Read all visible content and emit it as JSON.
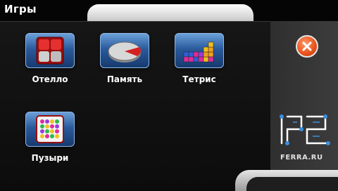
{
  "window": {
    "title": "Игры"
  },
  "apps": [
    {
      "label": "Отелло",
      "icon": "othello-icon"
    },
    {
      "label": "Память",
      "icon": "memory-icon"
    },
    {
      "label": "Тетрис",
      "icon": "tetris-icon"
    },
    {
      "label": "Пузыри",
      "icon": "bubbles-icon"
    }
  ],
  "close": {
    "icon": "close-icon"
  },
  "watermark": {
    "text": "FERRA.RU"
  },
  "colors": {
    "accent": "#2a5a9c",
    "close": "#e8501a"
  }
}
